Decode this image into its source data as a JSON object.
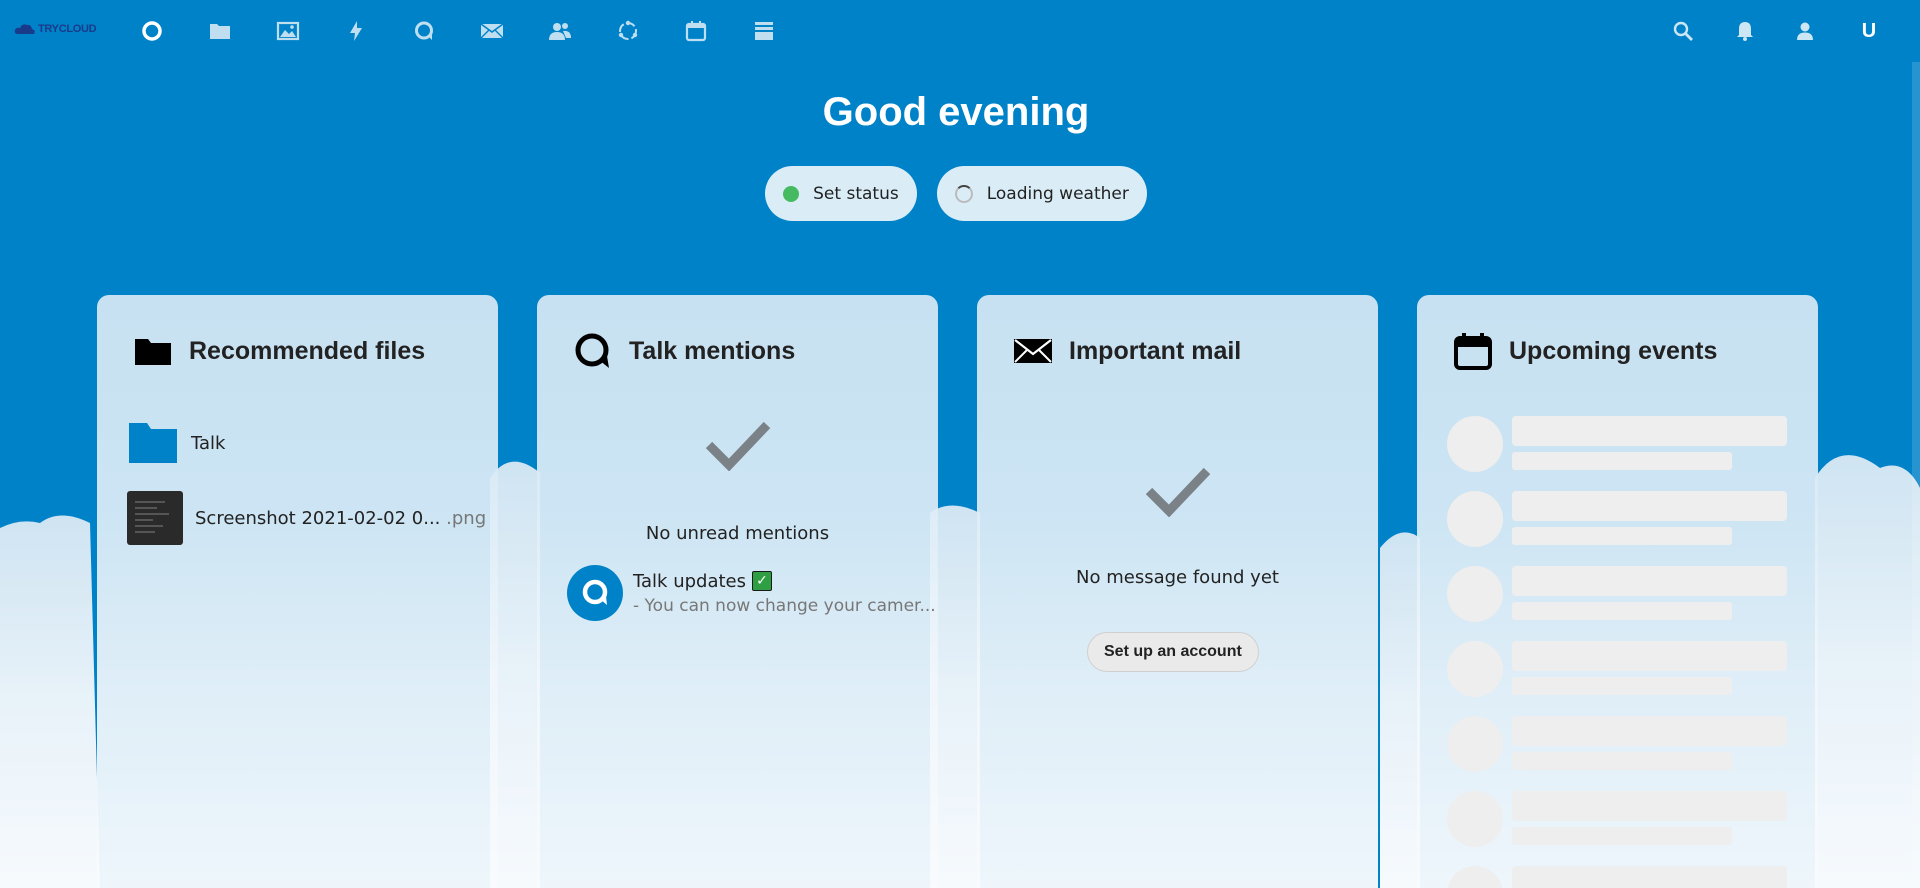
{
  "app": {
    "logo_text": "TRYCLOUD",
    "user_initial": "U"
  },
  "nav": {
    "items": [
      {
        "name": "dashboard",
        "icon": "circle-icon"
      },
      {
        "name": "files",
        "icon": "folder-icon"
      },
      {
        "name": "photos",
        "icon": "image-icon"
      },
      {
        "name": "activity",
        "icon": "lightning-icon"
      },
      {
        "name": "talk",
        "icon": "talk-icon"
      },
      {
        "name": "mail",
        "icon": "mail-icon"
      },
      {
        "name": "contacts",
        "icon": "contacts-icon"
      },
      {
        "name": "circles",
        "icon": "circles-icon"
      },
      {
        "name": "calendar",
        "icon": "calendar-icon"
      },
      {
        "name": "deck",
        "icon": "deck-icon"
      }
    ],
    "right": [
      "search-icon",
      "bell-icon",
      "contacts-menu-icon"
    ]
  },
  "greeting": "Good evening",
  "status": {
    "set_status": "Set status",
    "weather": "Loading weather"
  },
  "colors": {
    "primary": "#0082c9",
    "online": "#46ba61"
  },
  "panels": {
    "files": {
      "title": "Recommended files",
      "items": [
        {
          "name": "Talk",
          "ext": ""
        },
        {
          "name": "Screenshot 2021-02-02 0...",
          "ext": " .png"
        }
      ]
    },
    "talk": {
      "title": "Talk mentions",
      "empty": "No unread mentions",
      "update_title": "Talk updates",
      "update_emoji": "✓",
      "update_text": "- You can now change your camer..."
    },
    "mail": {
      "title": "Important mail",
      "empty": "No message found yet",
      "setup": "Set up an account"
    },
    "events": {
      "title": "Upcoming events",
      "skeleton_rows": 7
    }
  }
}
